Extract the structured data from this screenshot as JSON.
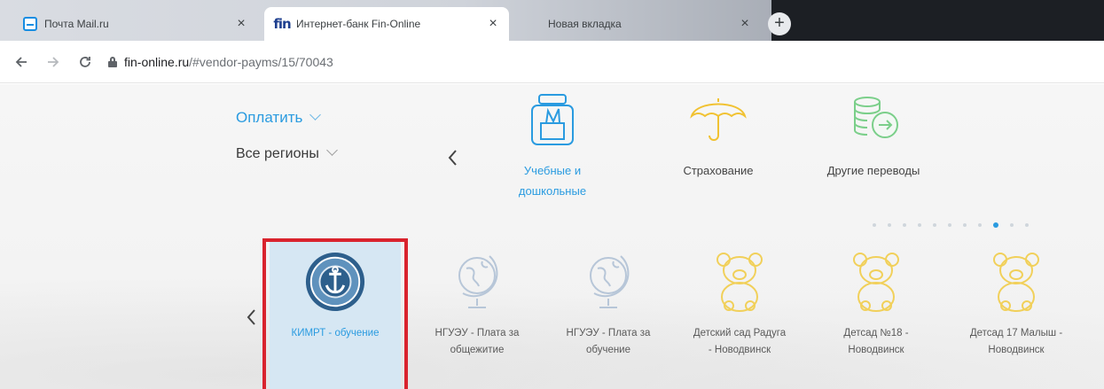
{
  "browser": {
    "tabs": [
      {
        "title": "Почта Mail.ru",
        "favicon": "mail-icon"
      },
      {
        "title": "Интернет-банк Fin-Online",
        "favicon": "fin-logo-icon",
        "favicon_text": "fin"
      },
      {
        "title": "Новая вкладка",
        "favicon": "blank-icon"
      }
    ],
    "new_tab_label": "+",
    "close_glyph": "×",
    "address": {
      "host": "fin-online.ru",
      "path": "/#vendor-payms/15/70043"
    }
  },
  "page": {
    "pay_menu_label": "Оплатить",
    "region_menu_label": "Все регионы",
    "categories": [
      {
        "line1": "Учебные и",
        "line2": "дошкольные",
        "icon": "backpack-icon",
        "active": true
      },
      {
        "line1": "Страхование",
        "line2": "",
        "icon": "umbrella-icon",
        "active": false
      },
      {
        "line1": "Другие переводы",
        "line2": "",
        "icon": "coins-transfer-icon",
        "active": false
      }
    ],
    "pagination": {
      "count": 11,
      "active_index": 8
    },
    "providers": [
      {
        "line1": "КИМРТ - обучение",
        "line2": "",
        "icon": "anchor-emblem-icon",
        "selected": true
      },
      {
        "line1": "НГУЭУ - Плата за",
        "line2": "общежитие",
        "icon": "globe-icon",
        "selected": false
      },
      {
        "line1": "НГУЭУ - Плата за",
        "line2": "обучение",
        "icon": "globe-icon",
        "selected": false
      },
      {
        "line1": "Детский сад Радуга",
        "line2": "- Новодвинск",
        "icon": "teddy-bear-icon",
        "selected": false
      },
      {
        "line1": "Детсад №18 -",
        "line2": "Новодвинск",
        "icon": "teddy-bear-icon",
        "selected": false
      },
      {
        "line1": "Детсад 17 Малыш -",
        "line2": "Новодвинск",
        "icon": "teddy-bear-icon",
        "selected": false
      }
    ],
    "colors": {
      "accent": "#2a9be0",
      "selection": "#d6e7f3",
      "highlight_frame": "#d9232d"
    }
  }
}
